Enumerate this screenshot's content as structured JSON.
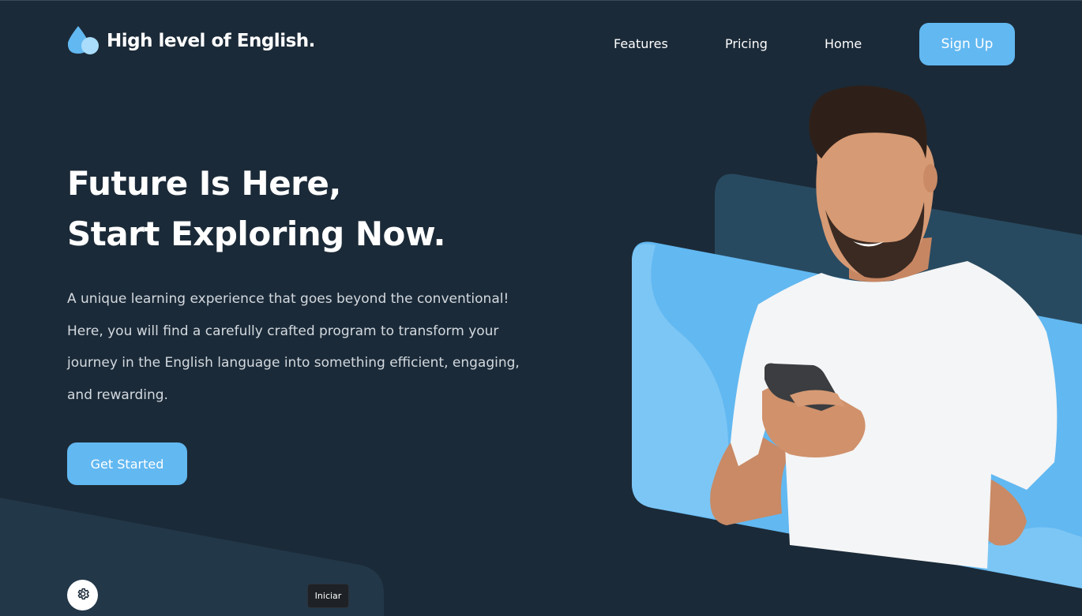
{
  "header": {
    "logo_text": "High level of English.",
    "nav": [
      {
        "label": "Features"
      },
      {
        "label": "Pricing"
      },
      {
        "label": "Home"
      }
    ],
    "signup_label": "Sign Up"
  },
  "hero": {
    "headline_line1": "Future Is Here,",
    "headline_line2": "Start Exploring Now.",
    "description": "A unique learning experience that goes beyond the conventional! Here, you will find a carefully crafted program to transform your journey in the English language into something efficient, engaging, and rewarding.",
    "cta_label": "Get Started",
    "image_alt": "smiling man in white t-shirt holding a smartphone"
  },
  "footer": {
    "settings_icon": "gear-icon",
    "iniciar_label": "Iniciar"
  },
  "colors": {
    "background": "#1b2a38",
    "accent": "#62b8f1",
    "panel_dark": "#284a60",
    "text_muted": "#d3d9df"
  }
}
